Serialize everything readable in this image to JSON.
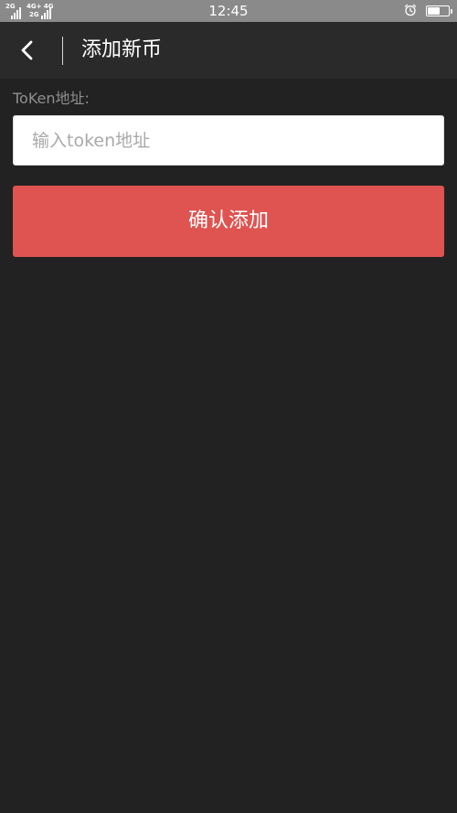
{
  "status_bar": {
    "time": "12:45",
    "sim1_network": "2G",
    "sim2_network_top": "4G+ 4G",
    "sim2_network_bottom": "2G",
    "alarm_icon": "alarm-clock-icon",
    "battery_icon": "battery-icon",
    "battery_level": 0.6
  },
  "header": {
    "back_icon": "chevron-left-icon",
    "title": "添加新币"
  },
  "form": {
    "token_label": "ToKen地址:",
    "token_value": "",
    "token_placeholder": "输入token地址",
    "confirm_label": "确认添加"
  },
  "colors": {
    "background": "#222222",
    "header_background": "#2a2a2a",
    "status_bar": "#8a8a8a",
    "accent": "#df5350",
    "label_text": "#8f8f8f",
    "placeholder": "#a9a9a9"
  }
}
